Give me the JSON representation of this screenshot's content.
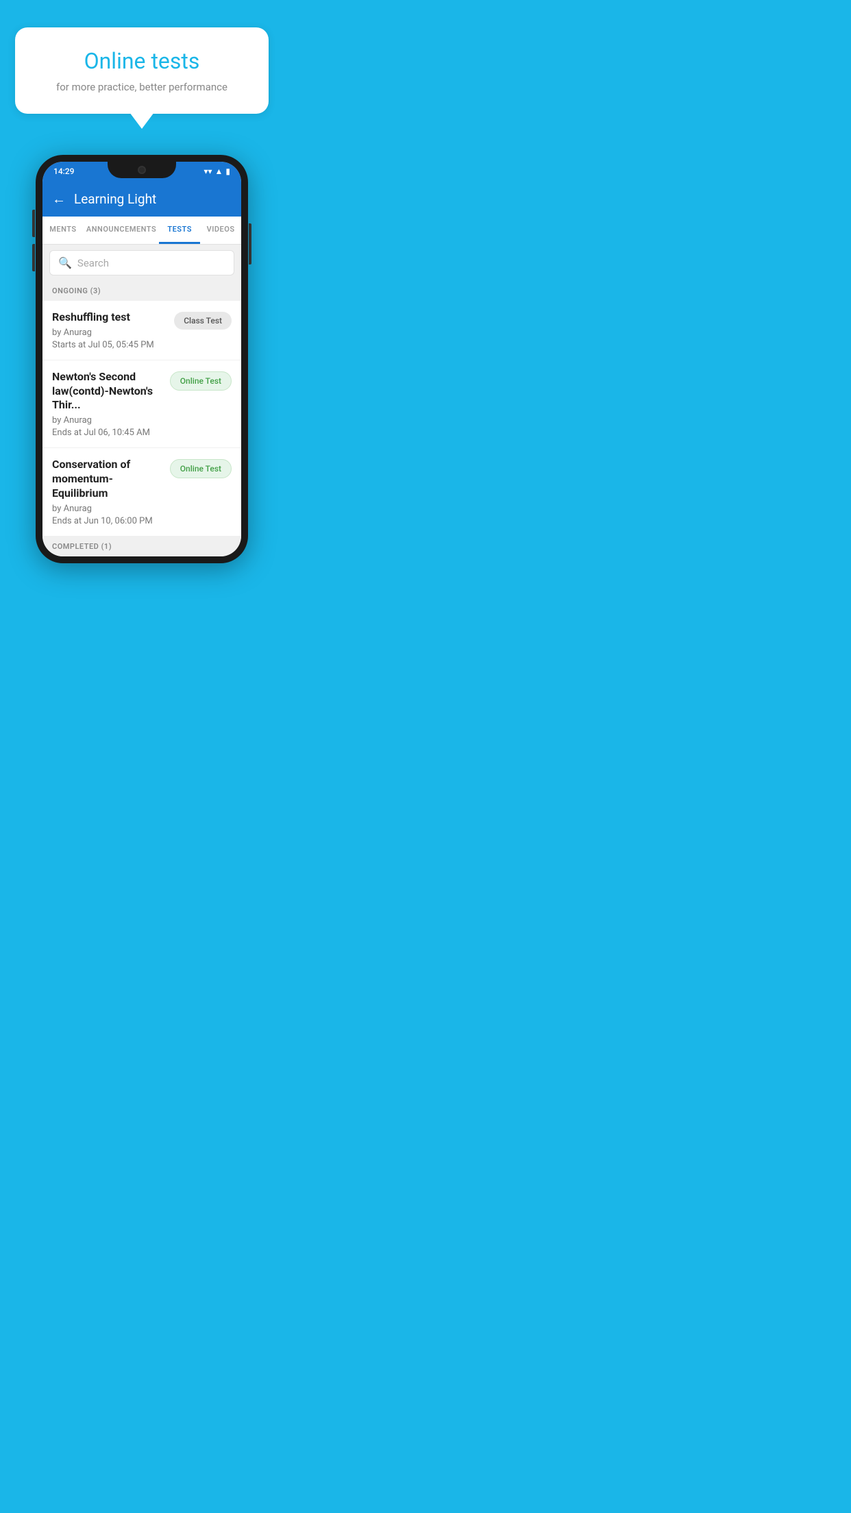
{
  "background_color": "#1ab6e8",
  "speech_bubble": {
    "title": "Online tests",
    "subtitle": "for more practice, better performance"
  },
  "phone": {
    "status_bar": {
      "time": "14:29",
      "wifi": "▾",
      "signal": "▲",
      "battery": "▮"
    },
    "app_bar": {
      "back_label": "←",
      "title": "Learning Light"
    },
    "tabs": [
      {
        "label": "MENTS",
        "active": false
      },
      {
        "label": "ANNOUNCEMENTS",
        "active": false
      },
      {
        "label": "TESTS",
        "active": true
      },
      {
        "label": "VIDEOS",
        "active": false
      }
    ],
    "search": {
      "placeholder": "Search"
    },
    "ongoing_section": {
      "header": "ONGOING (3)",
      "items": [
        {
          "name": "Reshuffling test",
          "by": "by Anurag",
          "date": "Starts at  Jul 05, 05:45 PM",
          "badge": "Class Test",
          "badge_type": "class"
        },
        {
          "name": "Newton's Second law(contd)-Newton's Thir...",
          "by": "by Anurag",
          "date": "Ends at  Jul 06, 10:45 AM",
          "badge": "Online Test",
          "badge_type": "online"
        },
        {
          "name": "Conservation of momentum-Equilibrium",
          "by": "by Anurag",
          "date": "Ends at  Jun 10, 06:00 PM",
          "badge": "Online Test",
          "badge_type": "online"
        }
      ]
    },
    "completed_section": {
      "header": "COMPLETED (1)"
    }
  }
}
